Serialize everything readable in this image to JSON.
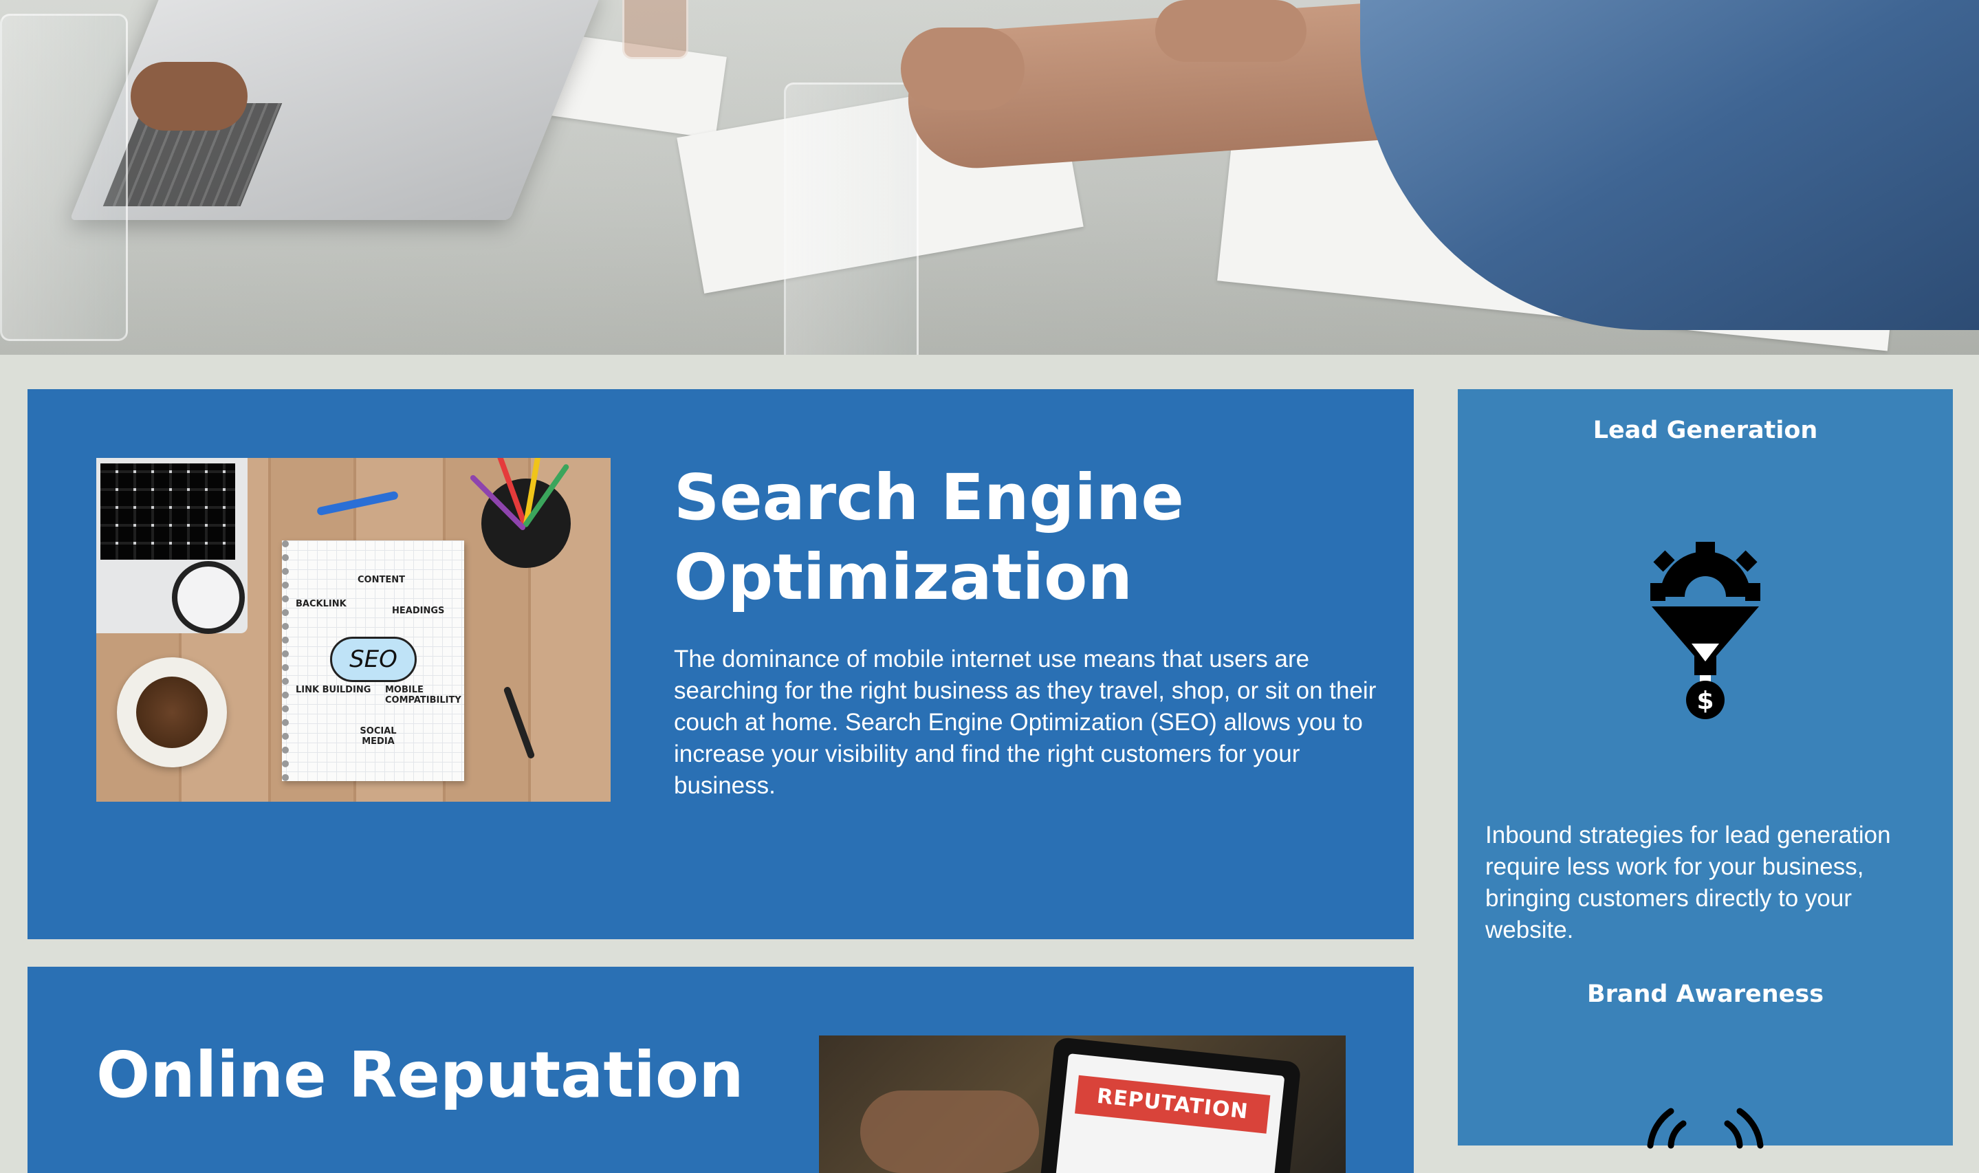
{
  "seo": {
    "title": "Search Engine Optimization",
    "body": "The dominance of mobile internet use means that users are searching for the right business as they travel, shop, or sit on their couch at home. Search Engine Optimization (SEO) allows you to increase your visibility and find the right customers for your business.",
    "image_words": {
      "content": "CONTENT",
      "backlink": "BACKLINK",
      "headings": "HEADINGS",
      "seo": "SEO",
      "link_building": "LINK BUILDING",
      "mobile": "MOBILE COMPATIBILITY",
      "social": "SOCIAL MEDIA"
    }
  },
  "reputation": {
    "title": "Online Reputation",
    "image_banner": "REPUTATION"
  },
  "sidebar": {
    "lead_heading": "Lead Generation",
    "lead_icon": "funnel-gear-dollar-icon",
    "lead_text": "Inbound strategies for lead generation require less work for your business, bringing customers directly to your website.",
    "brand_heading": "Brand Awareness",
    "brand_icon": "broadcast-icon"
  },
  "colors": {
    "page_bg": "#dcdfd8",
    "card_blue": "#2a70b4",
    "sidebar_blue": "#3a82b9",
    "text": "#ffffff"
  }
}
